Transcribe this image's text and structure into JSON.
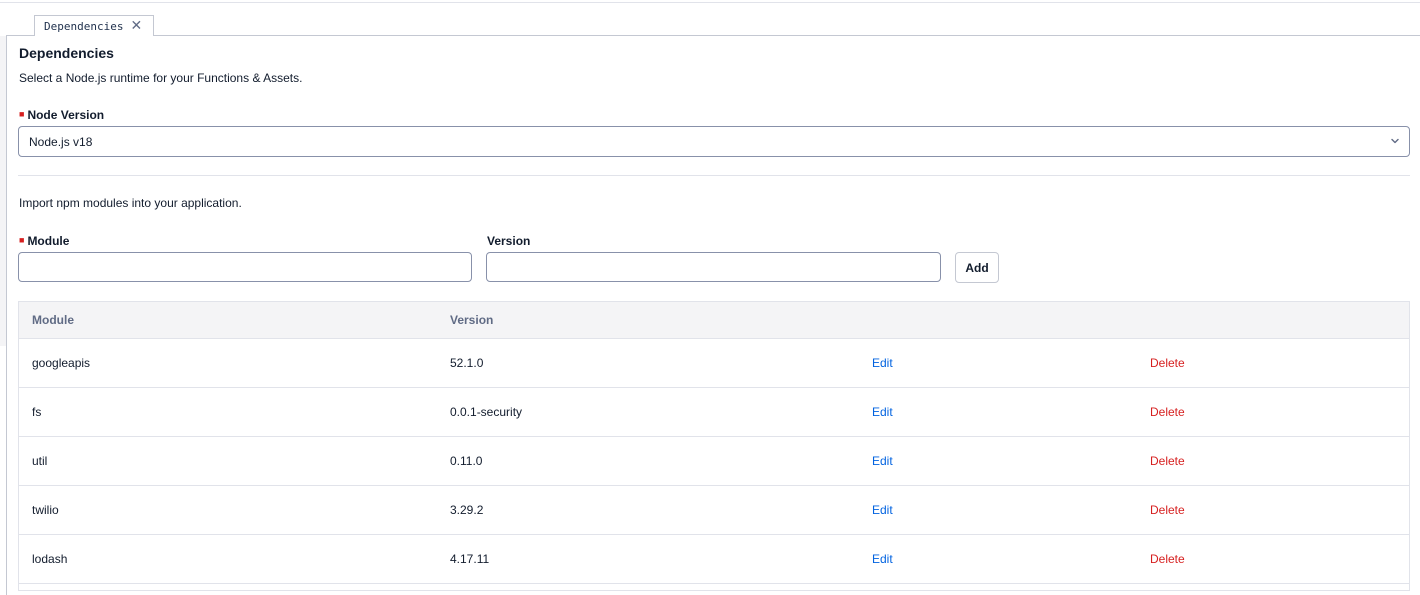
{
  "tab": {
    "label": "Dependencies"
  },
  "panel": {
    "title": "Dependencies",
    "description": "Select a Node.js runtime for your Functions & Assets."
  },
  "node_version": {
    "label": "Node Version",
    "selected": "Node.js v18"
  },
  "npm": {
    "description": "Import npm modules into your application.",
    "module_label": "Module",
    "version_label": "Version",
    "module_value": "",
    "version_value": "",
    "add_label": "Add"
  },
  "table": {
    "headers": [
      "Module",
      "Version"
    ],
    "edit_label": "Edit",
    "delete_label": "Delete",
    "rows": [
      {
        "module": "googleapis",
        "version": "52.1.0"
      },
      {
        "module": "fs",
        "version": "0.0.1-security"
      },
      {
        "module": "util",
        "version": "0.11.0"
      },
      {
        "module": "twilio",
        "version": "3.29.2"
      },
      {
        "module": "lodash",
        "version": "4.17.11"
      }
    ]
  },
  "colors": {
    "link": "#0263e0",
    "danger": "#d61f1f",
    "required": "#d61f1f"
  }
}
